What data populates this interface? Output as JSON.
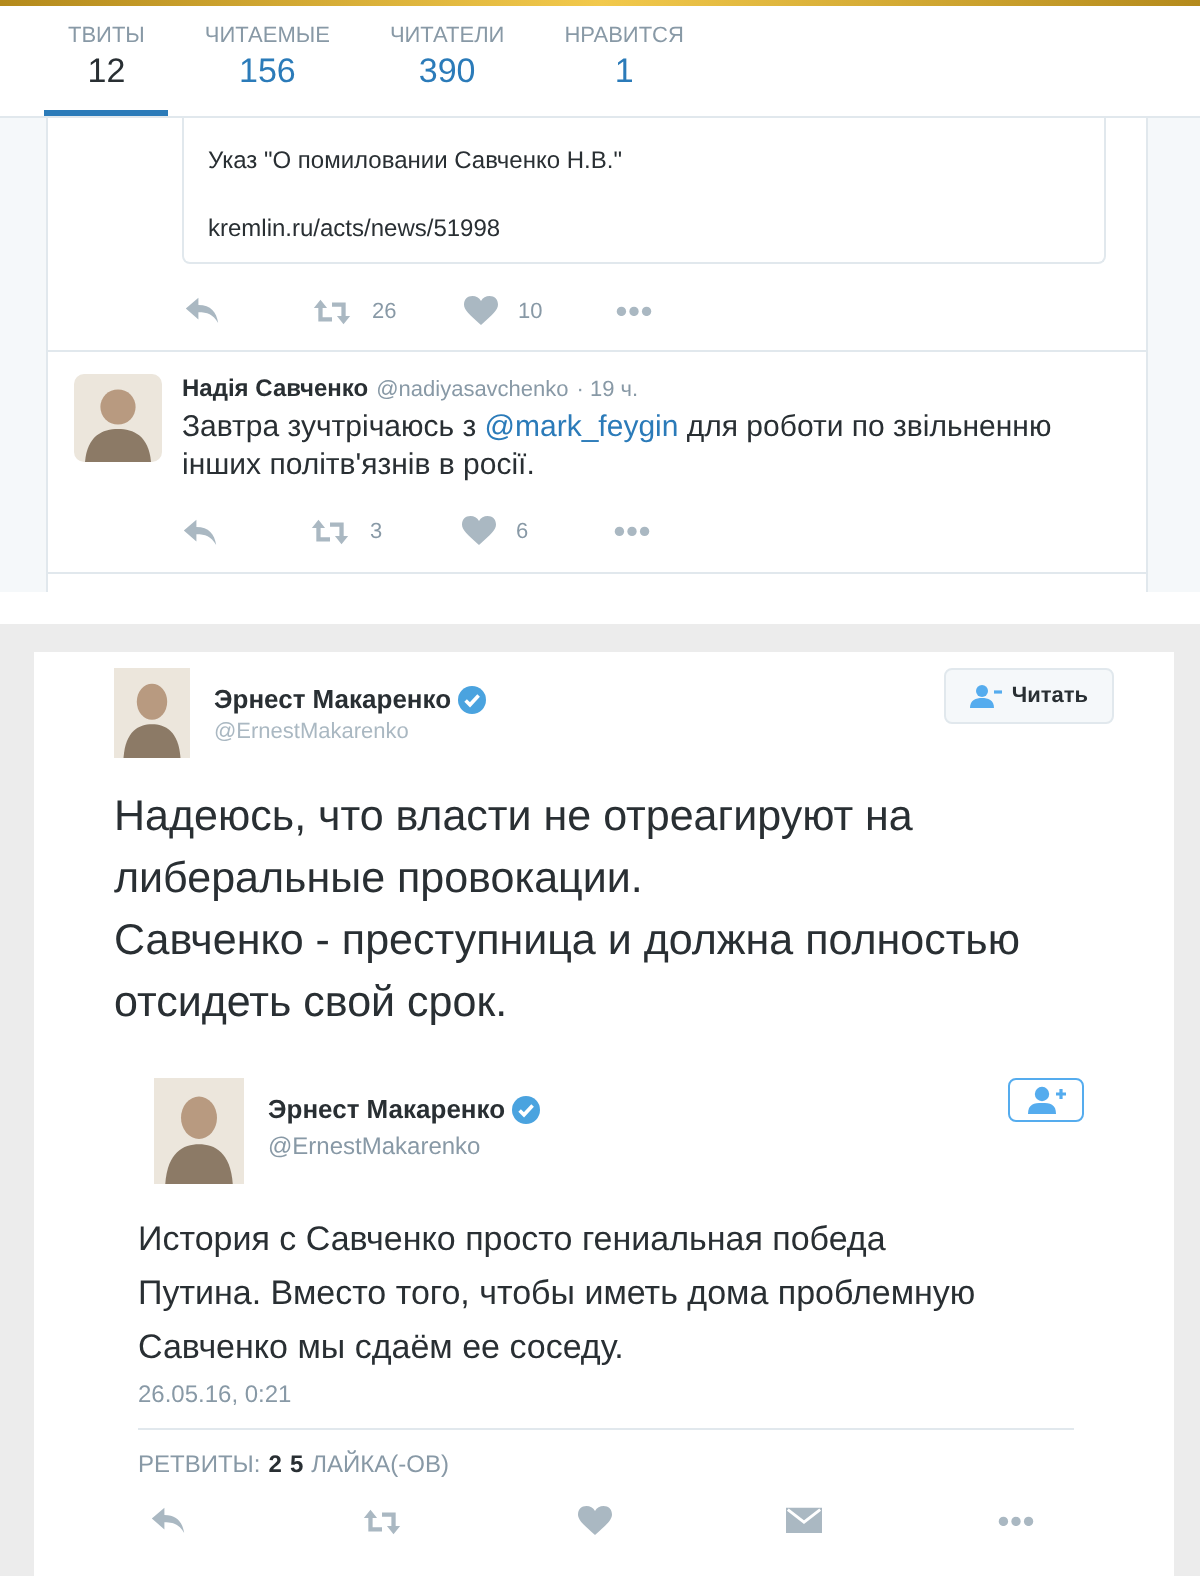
{
  "stats": [
    {
      "label": "ТВИТЫ",
      "value": "12",
      "selected": true
    },
    {
      "label": "ЧИТАЕМЫЕ",
      "value": "156",
      "selected": false
    },
    {
      "label": "ЧИТАТЕЛИ",
      "value": "390",
      "selected": false
    },
    {
      "label": "НРАВИТСЯ",
      "value": "1",
      "selected": false
    }
  ],
  "quoted_tweet": {
    "text": "Указ \"О помиловании Савченко Н.В.\"",
    "link": "kremlin.ru/acts/news/51998",
    "retweets": "26",
    "likes": "10"
  },
  "tweet": {
    "name": "Надія Савченко",
    "handle": "@nadiyasavchenko",
    "time": "· 19 ч.",
    "text_before": "Завтра зучтрічаюсь з",
    "mention": "@mark_feygin",
    "text_after": "для роботи по звільненню інших політв'язнів в росії.",
    "retweets": "3",
    "likes": "6"
  },
  "embed": {
    "name": "Эрнест Макаренко",
    "handle": "@ErnestMakarenko",
    "verified": true,
    "follow_label": "Читать",
    "paragraphs": [
      "Надеюсь, что власти не отреагируют на либеральные провокации.",
      "Савченко - преступница и должна полностью отсидеть свой срок."
    ]
  },
  "inner_tweet": {
    "name": "Эрнест Макаренко",
    "handle": "@ErnestMakarenko",
    "verified": true,
    "text": "История с Савченко просто гениальная победа Путина. Вместо того, чтобы иметь дома проблемную Савченко мы сдаём ее соседу.",
    "date": "26.05.16, 0:21",
    "retweets_label": "РЕТВИТЫ:",
    "retweets": "2",
    "likes": "5",
    "likes_label": "ЛАЙКА(-ОВ)"
  }
}
